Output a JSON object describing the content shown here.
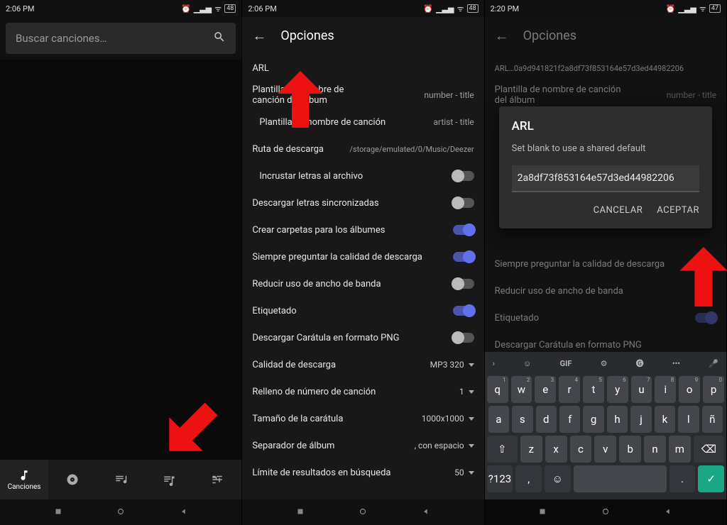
{
  "statusA": {
    "time": "2:06 PM",
    "battery": "48"
  },
  "statusB": {
    "time": "2:06 PM",
    "battery": "48"
  },
  "statusC": {
    "time": "2:20 PM",
    "battery": "47"
  },
  "search": {
    "placeholder": "Buscar canciones…"
  },
  "tabs": {
    "songs": "Canciones"
  },
  "options": {
    "title": "Opciones",
    "arl": "ARL",
    "albumTpl": {
      "label": "Plantilla de nombre de canción del álbum",
      "value": "number - title"
    },
    "songTpl": {
      "label": "Plantilla de nombre de canción",
      "value": "artist - title"
    },
    "path": {
      "label": "Ruta de descarga",
      "value": "/storage/emulated/0/Music/Deezer"
    },
    "embedLyrics": "Incrustar letras al archivo",
    "syncLyrics": "Descargar letras sincronizadas",
    "albumFolders": "Crear carpetas para los álbumes",
    "askQuality": "Siempre preguntar la calidad de descarga",
    "reduceBw": "Reducir uso de ancho de banda",
    "tagging": "Etiquetado",
    "pngCover": "Descargar Carátula en formato PNG",
    "quality": {
      "label": "Calidad de descarga",
      "value": "MP3 320"
    },
    "trackPad": {
      "label": "Relleno de número de canción",
      "value": "1"
    },
    "coverSize": {
      "label": "Tamaño de la carátula",
      "value": "1000x1000"
    },
    "albumSep": {
      "label": "Separador de álbum",
      "value": ", con espacio"
    },
    "searchLimit": {
      "label": "Límite de resultados en búsqueda",
      "value": "50"
    }
  },
  "pane3": {
    "arlLine": "ARL…0a9d941821f2a8df73f853164e57d3ed44982206"
  },
  "dialog": {
    "title": "ARL",
    "hint": "Set blank to use a shared default",
    "value": "2a8df73f853164e57d3ed44982206",
    "cancel": "CANCELAR",
    "accept": "ACEPTAR"
  },
  "kb": {
    "row1": [
      "q",
      "w",
      "e",
      "r",
      "t",
      "y",
      "u",
      "i",
      "o",
      "p"
    ],
    "sup1": [
      "1",
      "2",
      "3",
      "4",
      "5",
      "6",
      "7",
      "8",
      "9",
      "0"
    ],
    "row2": [
      "a",
      "s",
      "d",
      "f",
      "g",
      "h",
      "j",
      "k",
      "l",
      "ñ"
    ],
    "row3": [
      "z",
      "x",
      "c",
      "v",
      "b",
      "n",
      "m"
    ],
    "sym": "?123",
    "gif": "GIF"
  }
}
